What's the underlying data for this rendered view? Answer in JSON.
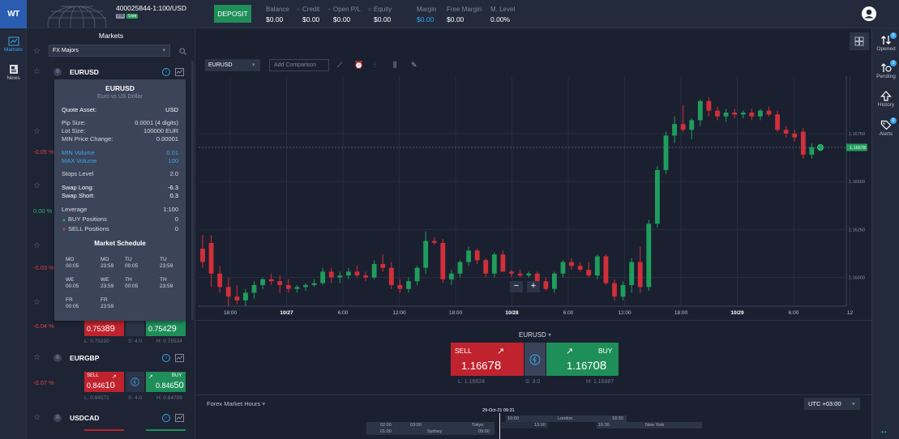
{
  "header": {
    "logo_text": "WT",
    "account_number": "400025844-1:100/USD",
    "account_badge": "FR",
    "account_mode": "Live",
    "deposit_label": "DEPOSIT",
    "stats": [
      {
        "label": "Balance",
        "value": "$0.00"
      },
      {
        "label": "Credit",
        "value": "$0.00"
      },
      {
        "label": "Open P/L",
        "value": "$0.00"
      },
      {
        "label": "Equity",
        "value": "$0.00"
      },
      {
        "label": "Margin",
        "value": "$0.00"
      },
      {
        "label": "Free Margin",
        "value": "$0.00"
      },
      {
        "label": "M. Level",
        "value": "0.00%"
      }
    ]
  },
  "left_rail": {
    "markets_label": "Markets",
    "news_label": "News"
  },
  "markets": {
    "title": "Markets",
    "filter_value": "FX Majors",
    "rows": [
      {
        "symbol": "EURUSD",
        "count": "0"
      },
      {
        "symbol": "EURGBP",
        "count": "0",
        "change": "-0.07 %",
        "sell_label": "SELL",
        "sell_price_main": "0.846",
        "sell_price_big": "10",
        "buy_label": "BUY",
        "buy_price_main": "0.846",
        "buy_price_big": "50",
        "low": "L: 0.84571",
        "spread": "S: 4.0",
        "high": "H: 0.84709"
      },
      {
        "symbol": "USDCAD",
        "count": "0"
      }
    ],
    "partial_rows": [
      {
        "change": "-0.05 %"
      },
      {
        "change": "0.00 %"
      },
      {
        "change": "-0.03 %"
      },
      {
        "change": "-0.04 %",
        "sell_price_main": "0.753",
        "sell_price_big": "89",
        "buy_price_main": "0.754",
        "buy_price_big": "29",
        "low": "L: 0.75220",
        "spread": "S: 4.0",
        "high": "H: 0.75534"
      }
    ]
  },
  "tooltip": {
    "symbol": "EURUSD",
    "description": "Euro vs US Dollar",
    "quote_asset_label": "Quote Asset:",
    "quote_asset_value": "USD",
    "pip_size_label": "Pip Size:",
    "pip_size_value": "0.0001 (4 digits)",
    "lot_size_label": "Lot Size:",
    "lot_size_value": "100000 EUR",
    "min_price_change_label": "MIN Price Change:",
    "min_price_change_value": "0.00001",
    "min_volume_label": "MIN Volume",
    "min_volume_value": "0.01",
    "max_volume_label": "MAX Volume",
    "max_volume_value": "100",
    "stops_level_label": "Stops Level",
    "stops_level_value": "2.0",
    "swap_long_label": "Swap Long:",
    "swap_long_value": "-6.3",
    "swap_short_label": "Swap Short:",
    "swap_short_value": "0.3",
    "leverage_label": "Leverage",
    "leverage_value": "1:100",
    "buy_positions_label": "BUY Positions",
    "buy_positions_value": "0",
    "sell_positions_label": "SELL Positions",
    "sell_positions_value": "0",
    "schedule_title": "Market Schedule",
    "schedule": [
      {
        "day": "MO",
        "time": "00:05"
      },
      {
        "day": "MO",
        "time": "23:59"
      },
      {
        "day": "TU",
        "time": "00:05"
      },
      {
        "day": "TU",
        "time": "23:59"
      },
      {
        "day": "WE",
        "time": "00:05"
      },
      {
        "day": "WE",
        "time": "23:59"
      },
      {
        "day": "TH",
        "time": "00:05"
      },
      {
        "day": "TH",
        "time": "23:59"
      },
      {
        "day": "FR",
        "time": "00:05"
      },
      {
        "day": "FR",
        "time": "23:59"
      }
    ]
  },
  "chart": {
    "symbol_select": "EURUSD",
    "compare_placeholder": "Add Comparison",
    "price_tag": "1.16678",
    "zoom_out": "−",
    "zoom_in": "+"
  },
  "chart_data": {
    "type": "candlestick",
    "y_ticks": [
      "1.16750",
      "1.16500",
      "1.16250",
      "1.16000"
    ],
    "ylim": [
      1.1585,
      1.1705
    ],
    "x_ticks": [
      "18:00",
      "10/27",
      "6:00",
      "12:00",
      "18:00",
      "10/28",
      "6:00",
      "12:00",
      "18:00",
      "10/29",
      "6:00",
      "12"
    ],
    "current_price": 1.16678,
    "candles": [
      [
        1.1615,
        1.1622,
        1.1605,
        1.1608
      ],
      [
        1.1618,
        1.1622,
        1.1595,
        1.1602
      ],
      [
        1.1602,
        1.1606,
        1.1592,
        1.1595
      ],
      [
        1.1595,
        1.16,
        1.1585,
        1.159
      ],
      [
        1.159,
        1.1596,
        1.1586,
        1.1588
      ],
      [
        1.1588,
        1.1594,
        1.1585,
        1.1592
      ],
      [
        1.1592,
        1.1598,
        1.1589,
        1.1596
      ],
      [
        1.1596,
        1.16,
        1.1594,
        1.1599
      ],
      [
        1.1599,
        1.1602,
        1.1596,
        1.1598
      ],
      [
        1.1598,
        1.1601,
        1.1592,
        1.1596
      ],
      [
        1.1596,
        1.1599,
        1.1592,
        1.1594
      ],
      [
        1.1594,
        1.1596,
        1.1592,
        1.1595
      ],
      [
        1.1595,
        1.1597,
        1.1593,
        1.1596
      ],
      [
        1.1596,
        1.1599,
        1.1595,
        1.1597
      ],
      [
        1.1597,
        1.1605,
        1.1596,
        1.1603
      ],
      [
        1.1603,
        1.1605,
        1.1597,
        1.16
      ],
      [
        1.16,
        1.1603,
        1.1597,
        1.1601
      ],
      [
        1.1601,
        1.1605,
        1.1599,
        1.1603
      ],
      [
        1.1603,
        1.1606,
        1.16,
        1.1601
      ],
      [
        1.1601,
        1.1603,
        1.1598,
        1.16
      ],
      [
        1.16,
        1.1609,
        1.1599,
        1.1607
      ],
      [
        1.1607,
        1.1612,
        1.1603,
        1.1605
      ],
      [
        1.1605,
        1.1608,
        1.1594,
        1.1596
      ],
      [
        1.1596,
        1.1599,
        1.1592,
        1.1594
      ],
      [
        1.1594,
        1.16,
        1.1592,
        1.1598
      ],
      [
        1.1598,
        1.1606,
        1.1596,
        1.1605
      ],
      [
        1.1605,
        1.1624,
        1.1602,
        1.1619
      ],
      [
        1.1619,
        1.1621,
        1.1617,
        1.1618
      ],
      [
        1.1618,
        1.162,
        1.1597,
        1.1599
      ],
      [
        1.1599,
        1.1604,
        1.1596,
        1.1602
      ],
      [
        1.1602,
        1.1609,
        1.16,
        1.1608
      ],
      [
        1.1608,
        1.1616,
        1.1606,
        1.1614
      ],
      [
        1.1614,
        1.1615,
        1.1607,
        1.1609
      ],
      [
        1.1609,
        1.161,
        1.16,
        1.1602
      ],
      [
        1.1602,
        1.1613,
        1.16,
        1.1612
      ],
      [
        1.1612,
        1.1614,
        1.1603,
        1.1603
      ],
      [
        1.1603,
        1.1604,
        1.16,
        1.1602
      ],
      [
        1.1602,
        1.1604,
        1.16,
        1.1601
      ],
      [
        1.1601,
        1.1603,
        1.16,
        1.1602
      ],
      [
        1.1602,
        1.1603,
        1.1597,
        1.1598
      ],
      [
        1.1598,
        1.16,
        1.1593,
        1.1594
      ],
      [
        1.1594,
        1.1603,
        1.1592,
        1.1602
      ],
      [
        1.1602,
        1.1609,
        1.16,
        1.1608
      ],
      [
        1.1608,
        1.161,
        1.1604,
        1.1606
      ],
      [
        1.1606,
        1.1608,
        1.1603,
        1.1604
      ],
      [
        1.1604,
        1.1608,
        1.16,
        1.1601
      ],
      [
        1.1601,
        1.1612,
        1.1599,
        1.1611
      ],
      [
        1.1611,
        1.1612,
        1.1596,
        1.1597
      ],
      [
        1.1597,
        1.1599,
        1.1588,
        1.159
      ],
      [
        1.159,
        1.1598,
        1.1588,
        1.1596
      ],
      [
        1.1596,
        1.161,
        1.1592,
        1.1608
      ],
      [
        1.1608,
        1.1616,
        1.1592,
        1.1595
      ],
      [
        1.1595,
        1.163,
        1.1593,
        1.1628
      ],
      [
        1.1628,
        1.1658,
        1.1626,
        1.1656
      ],
      [
        1.1656,
        1.1676,
        1.1654,
        1.1674
      ],
      [
        1.1674,
        1.1684,
        1.167,
        1.168
      ],
      [
        1.168,
        1.169,
        1.1676,
        1.1677
      ],
      [
        1.1677,
        1.1683,
        1.1672,
        1.1682
      ],
      [
        1.1682,
        1.1693,
        1.1679,
        1.1692
      ],
      [
        1.1692,
        1.1694,
        1.1684,
        1.1687
      ],
      [
        1.1687,
        1.1689,
        1.1682,
        1.1684
      ],
      [
        1.1684,
        1.1688,
        1.1681,
        1.1686
      ],
      [
        1.1686,
        1.1688,
        1.1683,
        1.1685
      ],
      [
        1.1685,
        1.1687,
        1.1683,
        1.1686
      ],
      [
        1.1686,
        1.1688,
        1.1682,
        1.1684
      ],
      [
        1.1684,
        1.1688,
        1.1682,
        1.1687
      ],
      [
        1.1687,
        1.1689,
        1.1684,
        1.1685
      ],
      [
        1.1685,
        1.1687,
        1.1676,
        1.1677
      ],
      [
        1.1677,
        1.1679,
        1.1673,
        1.1675
      ],
      [
        1.1675,
        1.1677,
        1.1671,
        1.1673
      ],
      [
        1.1676,
        1.1678,
        1.1662,
        1.1664
      ],
      [
        1.1664,
        1.167,
        1.1662,
        1.1668
      ],
      [
        1.1668,
        1.1669,
        1.1666,
        1.1668
      ]
    ]
  },
  "trade": {
    "symbol": "EURUSD",
    "sell_label": "SELL",
    "sell_price_main": "1.166",
    "sell_price_big": "78",
    "buy_label": "BUY",
    "buy_price_main": "1.167",
    "buy_price_big": "08",
    "low": "L: 1.16624",
    "spread": "S: 3.0",
    "high": "H: 1.16887"
  },
  "hours": {
    "title": "Forex Market Hours",
    "timezone": "UTC +03:00",
    "now_label": "29-Oct-21 09:31",
    "sessions": [
      {
        "city": "London",
        "start": "10:00",
        "end": "18:30"
      },
      {
        "city": "Tokyo",
        "start": "03:00",
        "end": "12:00"
      },
      {
        "city": "New York",
        "start": "16:30",
        "end": "23:59"
      },
      {
        "city": "Sydney",
        "start": "01:00",
        "end": "09:00"
      }
    ],
    "tick_0200": "02:00",
    "tick_1300": "13:00"
  },
  "right_rail": {
    "opened_label": "Opened",
    "opened_count": "0",
    "pending_label": "Pending",
    "pending_count": "0",
    "history_label": "History",
    "alerts_label": "Alerts",
    "alerts_count": "0"
  },
  "colors": {
    "bull": "#1f9d5c",
    "bear": "#d12f39",
    "accent": "#3aa5e8"
  }
}
